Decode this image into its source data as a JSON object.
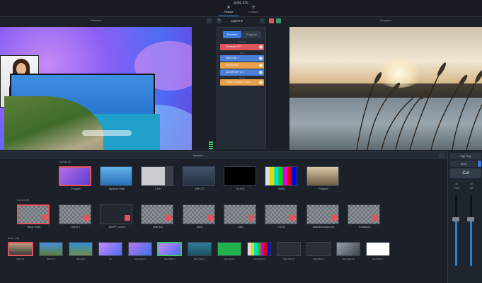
{
  "app": {
    "title": "AWS IPS"
  },
  "modes": [
    {
      "label": "Produce",
      "icon": "✕"
    },
    {
      "label": "Configure",
      "icon": "⚒"
    }
  ],
  "preview_panel": {
    "title": "Preview"
  },
  "layers_panel": {
    "title": "Layers",
    "toggle_preview": "Preview",
    "toggle_program": "Program",
    "captions": [
      "Graphics",
      "Main",
      "Shots"
    ],
    "items": [
      {
        "label": "Presenter PiP",
        "color": "red"
      },
      {
        "label": "NWS Clip 1",
        "color": "blue"
      },
      {
        "label": "ENG/UPD2",
        "color": "orange"
      },
      {
        "label": "AWS/RTMP In 2",
        "color": "blue"
      },
      {
        "label": "Offline Graphic 3 Elem...",
        "color": "orange"
      }
    ]
  },
  "program_panel": {
    "title": "Program"
  },
  "switcher": {
    "title": "Switcher"
  },
  "sections": {
    "layouts": "Layouts (5)",
    "scenes": "Scenes (9)",
    "shots": "Shots (13)"
  },
  "layouts": [
    "Program",
    "Squeeze Back",
    "L Bar",
    "With CG",
    "BLACK",
    "BARS",
    "Program"
  ],
  "scenes": [
    "Basic Shots",
    "Scene 1",
    "AWIPP Control",
    "Multi Box",
    "Intros",
    "Clips",
    "HTML",
    "Multiview Audio test",
    "Transitions"
  ],
  "shots": [
    "Shot 4.1",
    "Shot 4.2",
    "Shot 4.3",
    "V1",
    "New Shot 1",
    "New Shot 1",
    "New Shot 3",
    "New Shot 4",
    "New Shot 5",
    "New Shot 6",
    "New Shot 8",
    "New Shot 10",
    "New Shot 7"
  ],
  "right_panel": {
    "flip_flop": "Flip Flop",
    "slow": "Slow",
    "cut": "Cut",
    "pgm_label": "PGM",
    "bg_label": "BG",
    "pgm_db": "40",
    "bg_db": "40"
  },
  "colors": {
    "accent": "#3a7be0",
    "selected": "#e0555d",
    "live": "#3ec46a",
    "background": "#1c2129"
  }
}
